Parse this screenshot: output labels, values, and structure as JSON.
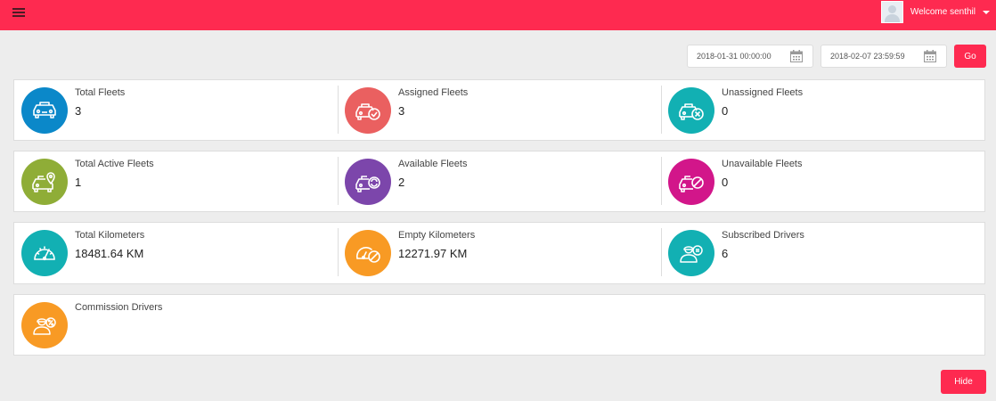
{
  "header": {
    "welcome_text": "Welcome senthil",
    "bar_color": "#fe2a50"
  },
  "filters": {
    "start_date": "2018-01-31 00:00:00",
    "end_date": "2018-02-07 23:59:59",
    "go_label": "Go"
  },
  "stats": {
    "total_fleets": {
      "label": "Total Fleets",
      "value": "3",
      "icon": "car-icon",
      "color": "#0b88c9"
    },
    "assigned_fleets": {
      "label": "Assigned Fleets",
      "value": "3",
      "icon": "car-check-icon",
      "color": "#ea6060"
    },
    "unassigned_fleets": {
      "label": "Unassigned Fleets",
      "value": "0",
      "icon": "car-x-icon",
      "color": "#12b0b3"
    },
    "total_active_fleets": {
      "label": "Total Active Fleets",
      "value": "1",
      "icon": "car-location-icon",
      "color": "#8fad37"
    },
    "available_fleets": {
      "label": "Available Fleets",
      "value": "2",
      "icon": "car-refresh-icon",
      "color": "#7c46ab"
    },
    "unavailable_fleets": {
      "label": "Unavailable Fleets",
      "value": "0",
      "icon": "car-blocked-icon",
      "color": "#d2168a"
    },
    "total_kilometers": {
      "label": "Total Kilometers",
      "value": "18481.64 KM",
      "icon": "speedometer-icon",
      "color": "#12b0b3"
    },
    "empty_kilometers": {
      "label": "Empty Kilometers",
      "value": "12271.97 KM",
      "icon": "speedometer-blocked-icon",
      "color": "#f89a24"
    },
    "subscribed_drivers": {
      "label": "Subscribed Drivers",
      "value": "6",
      "icon": "driver-subscription-icon",
      "color": "#12b0b3"
    },
    "commission_drivers": {
      "label": "Commission Drivers",
      "icon": "driver-commission-icon",
      "color": "#f89a24"
    }
  },
  "footer": {
    "hide_label": "Hide"
  }
}
